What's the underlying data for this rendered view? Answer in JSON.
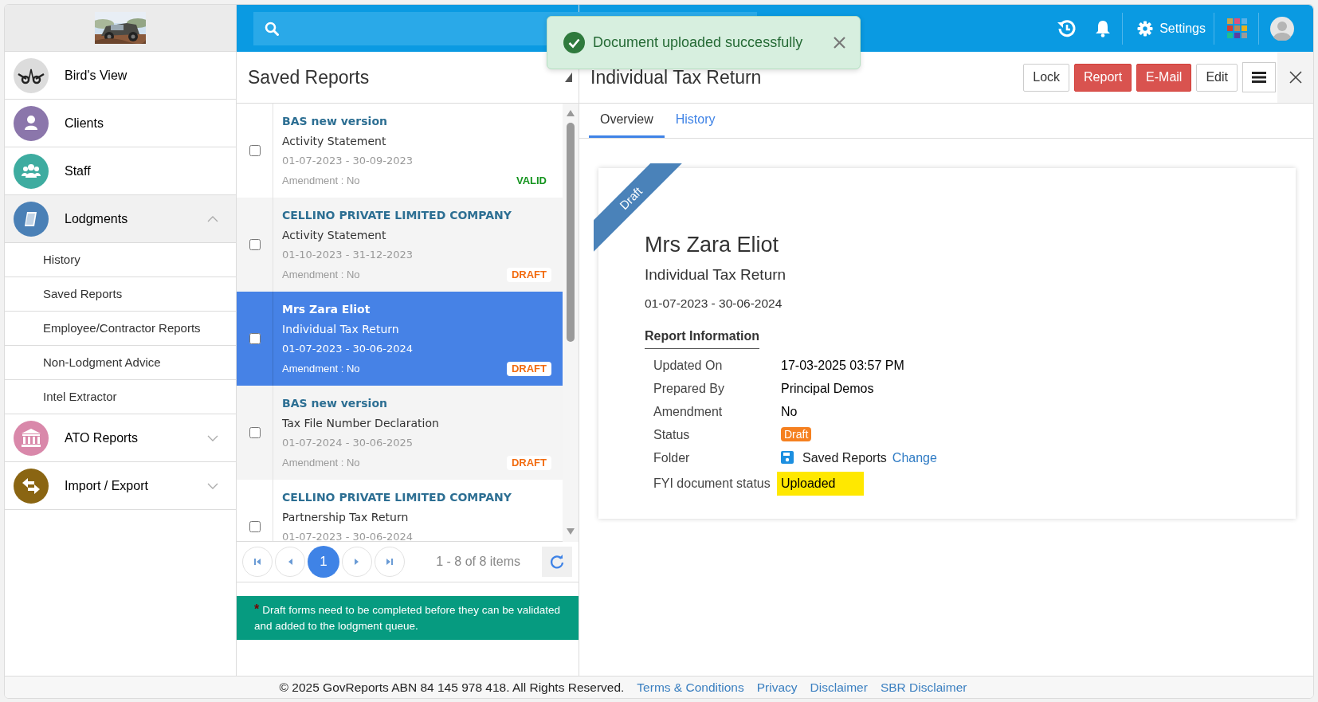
{
  "top_bar": {
    "settings_label": "Settings"
  },
  "toast": {
    "message": "Document uploaded successfully"
  },
  "sidebar": {
    "items": [
      {
        "label": "Bird's View",
        "kind": "link",
        "expanded": false
      },
      {
        "label": "Clients",
        "kind": "link",
        "expanded": false
      },
      {
        "label": "Staff",
        "kind": "link",
        "expanded": false
      },
      {
        "label": "Lodgments",
        "kind": "group",
        "expanded": true,
        "children": [
          {
            "label": "History"
          },
          {
            "label": "Saved Reports"
          },
          {
            "label": "Employee/Contractor Reports"
          },
          {
            "label": "Non-Lodgment Advice"
          },
          {
            "label": "Intel Extractor"
          }
        ]
      },
      {
        "label": "ATO Reports",
        "kind": "group",
        "expanded": false
      },
      {
        "label": "Import / Export",
        "kind": "group",
        "expanded": false
      }
    ]
  },
  "list": {
    "title": "Saved Reports",
    "items": [
      {
        "name": "BAS new version",
        "form": "Activity Statement",
        "period": "01-07-2023 - 30-09-2023",
        "amendment": "Amendment : No",
        "status": "VALID",
        "color": "#14941e",
        "selected": false,
        "checked": false
      },
      {
        "name": "CELLINO PRIVATE LIMITED COMPANY",
        "form": "Activity Statement",
        "period": "01-10-2023 - 31-12-2023",
        "amendment": "Amendment : No",
        "status": "DRAFT",
        "color": "#f26b0f",
        "selected": false,
        "checked": false
      },
      {
        "name": "Mrs Zara Eliot",
        "form": "Individual Tax Return",
        "period": "01-07-2023 - 30-06-2024",
        "amendment": "Amendment : No",
        "status": "DRAFT",
        "color": "#f26b0f",
        "selected": true,
        "checked": false
      },
      {
        "name": "BAS new version",
        "form": "Tax File Number Declaration",
        "period": "01-07-2024 - 30-06-2025",
        "amendment": "Amendment : No",
        "status": "DRAFT",
        "color": "#f26b0f",
        "selected": false,
        "checked": false
      },
      {
        "name": "CELLINO PRIVATE LIMITED COMPANY",
        "form": "Partnership Tax Return",
        "period": "01-07-2023 - 30-06-2024",
        "selected": false,
        "checked": false
      }
    ],
    "pagination": {
      "page": "1",
      "summary": "1 - 8 of 8 items"
    },
    "note_mark": "*",
    "note": "Draft forms need to be completed before they can be validated and added to the lodgment queue."
  },
  "detail": {
    "title": "Individual Tax Return",
    "buttons": [
      {
        "label": "Lock",
        "kind": "default"
      },
      {
        "label": "Report",
        "kind": "danger"
      },
      {
        "label": "E-Mail",
        "kind": "danger"
      },
      {
        "label": "Edit",
        "kind": "default"
      }
    ],
    "tabs": [
      {
        "label": "Overview",
        "selected": true
      },
      {
        "label": "History",
        "selected": false
      }
    ],
    "card": {
      "ribbon": "Draft",
      "name": "Mrs Zara Eliot",
      "form": "Individual Tax Return",
      "period": "01-07-2023 - 30-06-2024",
      "section": "Report Information",
      "fields": [
        {
          "label": "Updated On",
          "value": "17-03-2025 03:57 PM",
          "kind": "text"
        },
        {
          "label": "Prepared By",
          "value": "Principal Demos",
          "kind": "text"
        },
        {
          "label": "Amendment",
          "value": "No",
          "kind": "text"
        },
        {
          "label": "Status",
          "value": "Draft",
          "kind": "badge"
        },
        {
          "label": "Folder",
          "value": "Saved Reports",
          "link": "Change",
          "kind": "folder"
        },
        {
          "label": "FYI document status",
          "value": "Uploaded",
          "kind": "highlight"
        }
      ]
    }
  },
  "footer": {
    "copyright": "© 2025 GovReports ABN 84 145 978 418. All Rights Reserved.",
    "links": [
      "Terms & Conditions",
      "Privacy",
      "Disclaimer",
      "SBR Disclaimer"
    ]
  }
}
